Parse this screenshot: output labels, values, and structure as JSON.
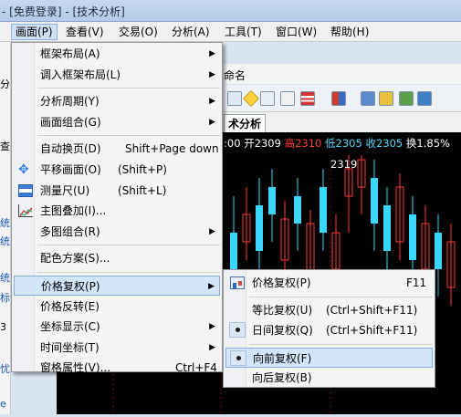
{
  "title": "- [免费登录] - [技术分析]",
  "menubar": [
    {
      "label": "画面(P)",
      "active": true
    },
    {
      "label": "查看(V)"
    },
    {
      "label": "交易(O)"
    },
    {
      "label": "分析(A)"
    },
    {
      "label": "工具(T)"
    },
    {
      "label": "窗口(W)"
    },
    {
      "label": "帮助(H)"
    }
  ],
  "background": {
    "name_fragment": "命名",
    "tab_label": "术分析",
    "quote": {
      "time": ":00",
      "open_label": "开2309",
      "high_label": "高2310",
      "low_label": "低2305",
      "close_label": "收2305",
      "turnover_label": "换1.85%"
    },
    "high_marker": "2319",
    "left_fragments": [
      "分",
      "查",
      "统",
      "统",
      "统",
      "标",
      "3",
      "忧",
      "e"
    ]
  },
  "main_menu": {
    "items": [
      {
        "label": "框架布局(A)",
        "submenu": true
      },
      {
        "label": "调入框架布局(L)",
        "submenu": true
      },
      {
        "separator": true
      },
      {
        "label": "分析周期(Y)",
        "submenu": true
      },
      {
        "label": "画面组合(G)",
        "submenu": true
      },
      {
        "separator": true
      },
      {
        "label": "自动换页(D)",
        "shortcut": "Shift+Page down"
      },
      {
        "label": "平移画面(O)",
        "shortcut": "(Shift+P)",
        "icon": "move-icon"
      },
      {
        "label": "测量尺(U)",
        "shortcut": "(Shift+L)",
        "icon": "ruler-icon"
      },
      {
        "label": "主图叠加(I)...",
        "icon": "overlay-chart-icon"
      },
      {
        "label": "多图组合(R)",
        "submenu": true
      },
      {
        "separator": true
      },
      {
        "label": "配色方案(S)..."
      },
      {
        "separator": true
      },
      {
        "label": "价格复权(P)",
        "submenu": true,
        "highlighted": true
      },
      {
        "label": "价格反转(E)"
      },
      {
        "label": "坐标显示(C)",
        "submenu": true
      },
      {
        "label": "时间坐标(T)",
        "submenu": true
      },
      {
        "label": "窗格属性(V)...",
        "shortcut": "Ctrl+F4"
      }
    ]
  },
  "sub_menu": {
    "items": [
      {
        "label": "价格复权(P)",
        "shortcut": "F11",
        "icon": "price-adjust-icon"
      },
      {
        "separator": true
      },
      {
        "label": "等比复权(U)",
        "shortcut": "(Ctrl+Shift+F11)"
      },
      {
        "label": "日间复权(Q)",
        "shortcut": "(Ctrl+Shift+F11)",
        "checked": true
      },
      {
        "separator": true
      },
      {
        "label": "向前复权(F)",
        "checked": true,
        "highlighted": true
      },
      {
        "label": "向后复权(B)"
      }
    ]
  },
  "colors": {
    "menu_highlight": "#d3e5fa",
    "chart_bg": "#000000",
    "candle_up": "#ff3b3b",
    "candle_down": "#3ad7ff"
  }
}
